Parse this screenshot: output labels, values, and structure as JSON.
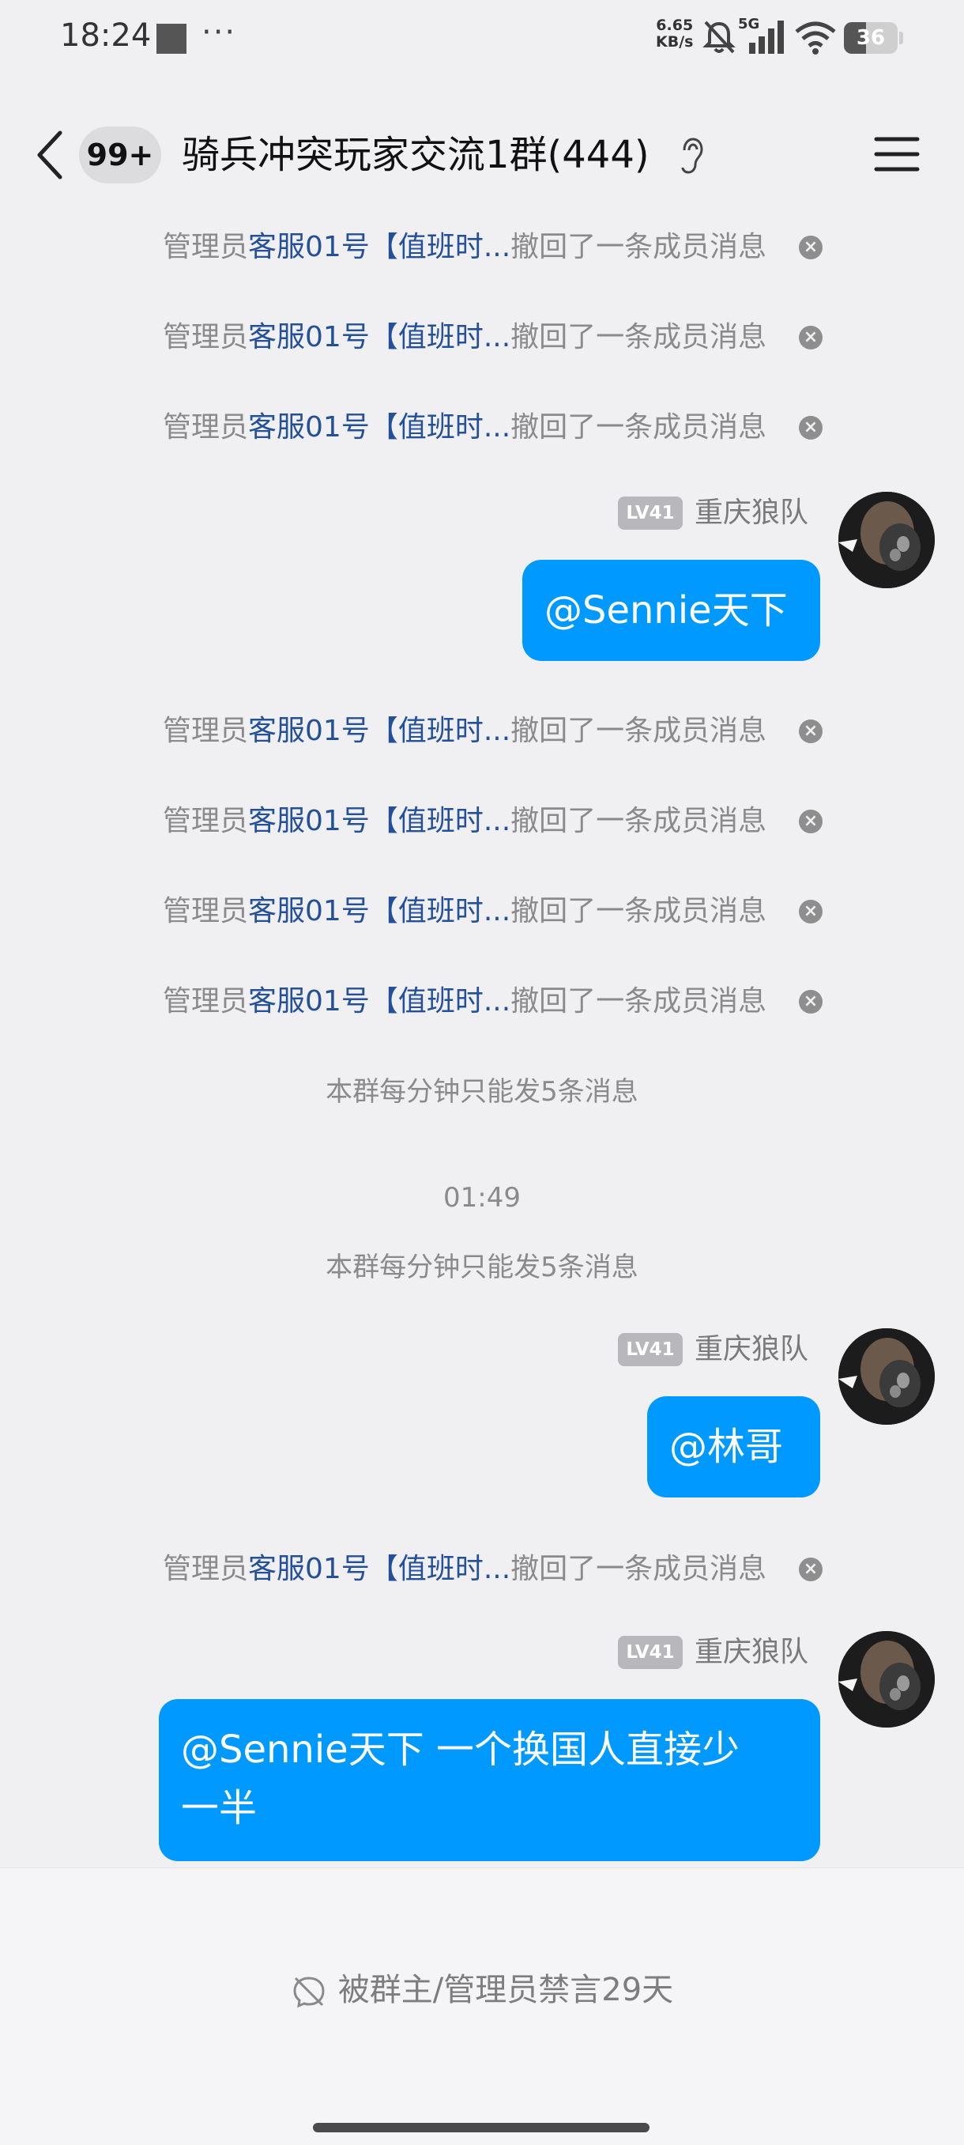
{
  "status_bar": {
    "time": "18:24",
    "dots": "···",
    "speed_value": "6.65",
    "speed_unit": "KB/s",
    "network": "5G",
    "battery": "36"
  },
  "header": {
    "unread_badge": "99+",
    "title": "骑兵冲突玩家交流1群(444)"
  },
  "notice": {
    "prefix": "管理员",
    "admin_name": "客服01号【值班时...",
    "suffix": "撤回了一条成员消息"
  },
  "system": {
    "rate_limit": "本群每分钟只能发5条消息",
    "timestamp": "01:49"
  },
  "sender": {
    "level": "LV41",
    "name": "重庆狼队"
  },
  "messages": {
    "m1": "@Sennie天下",
    "m2": "@林哥",
    "m3_line1": "@Sennie天下 一个换国人直接少",
    "m3_line2": "一半"
  },
  "footer": {
    "muted_text": "被群主/管理员禁言29天"
  },
  "colors": {
    "bubble": "#0099ff",
    "admin_link": "#24509a",
    "background": "#f0f0f3"
  },
  "icons": [
    "back-arrow-icon",
    "ear-icon",
    "menu-icon",
    "close-icon",
    "mute-icon",
    "wifi-icon",
    "signal-icon",
    "bell-off-icon"
  ]
}
